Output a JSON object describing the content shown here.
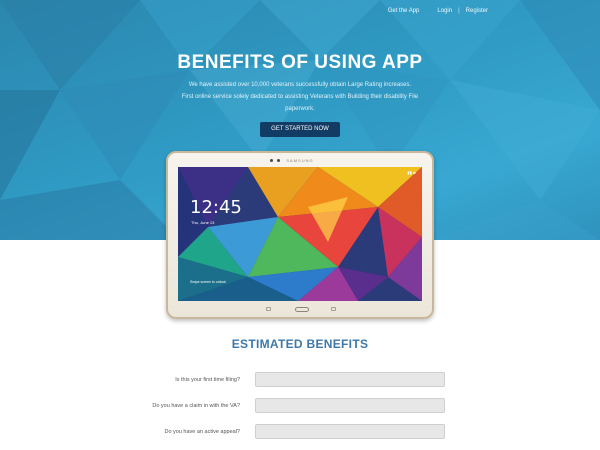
{
  "nav": {
    "get_app": "Get the App",
    "login": "Login",
    "separator": "|",
    "register": "Register"
  },
  "hero": {
    "title": "BENEFITS OF USING APP",
    "line1": "We have assisted over 10,000 veterans successfully obtain Large Rating increases.",
    "line2": "First online service solely dedicated to assisting Veterans with Building their disability File",
    "line3": "paperwork.",
    "cta_label": "GET STARTED NOW"
  },
  "tablet": {
    "brand": "SAMSUNG",
    "time": "12:45",
    "date": "Thu, June 13",
    "unlock_hint": "Swipe screen to unlock"
  },
  "benefits": {
    "title": "ESTIMATED BENEFITS",
    "questions": [
      {
        "label": "Is this your first time filing?",
        "value": ""
      },
      {
        "label": "Do you have a claim in with the VA?",
        "value": ""
      },
      {
        "label": "Do you have an active appeal?",
        "value": ""
      }
    ]
  },
  "colors": {
    "hero_bg": "#2f9ac3",
    "cta_bg": "#133c64",
    "section_title": "#3f79a8",
    "input_bg": "#e7e7e7"
  }
}
